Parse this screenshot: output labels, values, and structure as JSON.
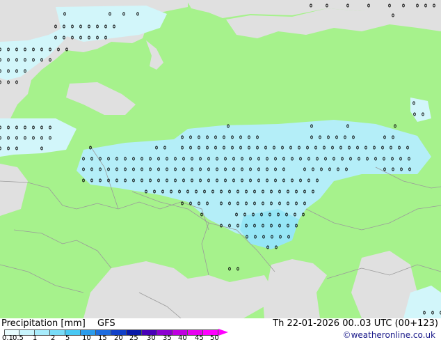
{
  "map": {
    "colors": {
      "land": "#a6f28c",
      "sea": "#e0e0e0",
      "precip_light": "#d2f6fa",
      "precip_mid": "#b4eef8",
      "precip_heavy": "#96e6f6",
      "border": "#9a9a9a",
      "marker": "#000000"
    }
  },
  "legend": {
    "title": "Precipitation [mm]",
    "model": "GFS",
    "levels": [
      "0.1",
      "0.5",
      "1",
      "2",
      "5",
      "10",
      "15",
      "20",
      "25",
      "30",
      "35",
      "40",
      "45",
      "50"
    ],
    "colors": [
      "#e8fcfe",
      "#c8f4fc",
      "#a8ecfc",
      "#78dcf8",
      "#48c8f4",
      "#2c9cec",
      "#1c6ce0",
      "#1040c8",
      "#0818a8",
      "#4800b8",
      "#8c00d0",
      "#c000e0",
      "#e800f0",
      "#ff00ff"
    ]
  },
  "valid_time": "Th 22-01-2026 00..03 UTC (00+123)",
  "credit": "©weatheronline.co.uk"
}
